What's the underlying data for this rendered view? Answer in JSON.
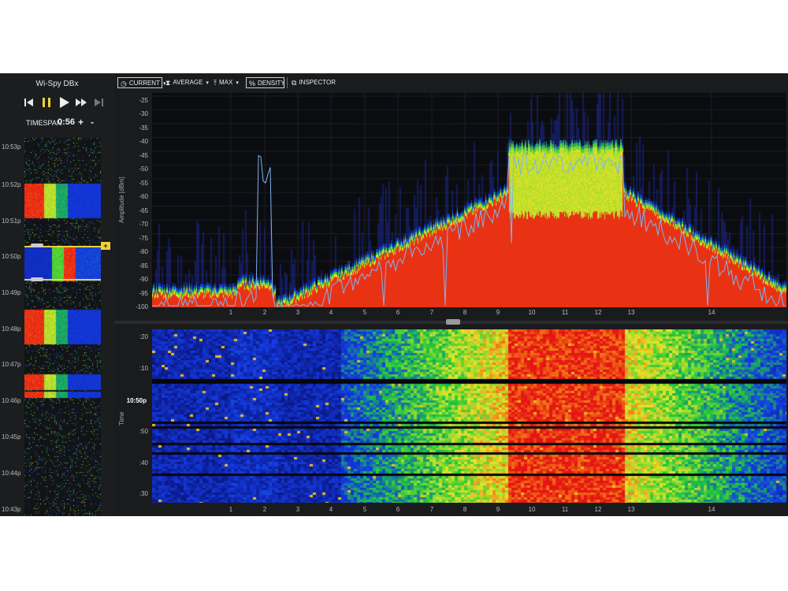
{
  "app": {
    "title": "Wi-Spy DBx"
  },
  "colors": {
    "background": "#1a1b1d",
    "accent": "#f2d13a",
    "trace": "#7db4f0"
  },
  "transport": {
    "buttons": [
      {
        "name": "skip-back-icon"
      },
      {
        "name": "pause-icon"
      },
      {
        "name": "play-icon"
      },
      {
        "name": "fast-forward-icon"
      },
      {
        "name": "skip-forward-icon"
      }
    ]
  },
  "timespan": {
    "label": "TIMESPAN",
    "value": "0:56",
    "plus": "+",
    "minus": "-"
  },
  "overview": {
    "times": [
      "10:53p",
      "10:52p",
      "10:51p",
      "10:50p",
      "10:49p",
      "10:48p",
      "10:47p",
      "10:46p",
      "10:45p",
      "10:44p",
      "10:43p"
    ],
    "selection_plus": "+"
  },
  "toolbar": {
    "current": "CURRENT",
    "average": "AVERAGE",
    "max": "MAX",
    "density": "DENSITY",
    "inspector": "INSPECTOR"
  },
  "spectrum": {
    "ylabel": "Amplitude [dBm]",
    "yticks": [
      "-25",
      "-30",
      "-35",
      "-40",
      "-45",
      "-50",
      "-55",
      "-60",
      "-65",
      "-70",
      "-75",
      "-80",
      "-85",
      "-90",
      "-95",
      "-100"
    ],
    "xticks": [
      "1",
      "2",
      "3",
      "4",
      "5",
      "6",
      "7",
      "8",
      "9",
      "10",
      "11",
      "12",
      "13",
      "14"
    ]
  },
  "waterfall": {
    "ylabel": "Time",
    "yticks": [
      ":20",
      ":10",
      "10:50p",
      ":50",
      ":40",
      ":30"
    ],
    "xticks": [
      "1",
      "2",
      "3",
      "4",
      "5",
      "6",
      "7",
      "8",
      "9",
      "10",
      "11",
      "12",
      "13",
      "14"
    ]
  }
}
